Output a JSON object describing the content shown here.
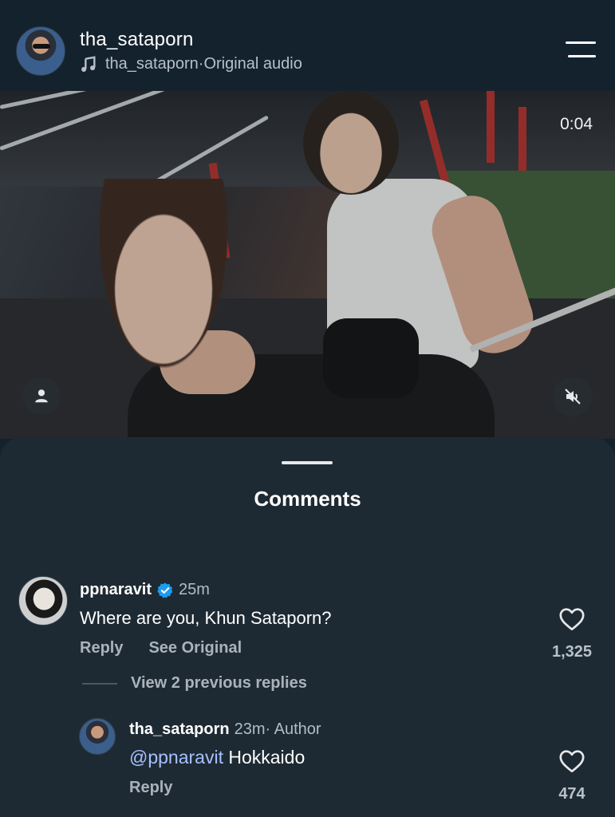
{
  "header": {
    "username": "tha_sataporn",
    "audio_owner": "tha_sataporn",
    "audio_separator": " · ",
    "audio_label": "Original audio"
  },
  "video": {
    "timer": "0:04",
    "icons": {
      "profile": "person-icon",
      "mute": "speaker-muted-icon"
    }
  },
  "comments_sheet": {
    "title": "Comments",
    "comment": {
      "username": "ppnaravit",
      "verified": true,
      "time": "25m",
      "text": "Where are you, Khun Sataporn?",
      "reply_label": "Reply",
      "see_original_label": "See Original",
      "like_count": "1,325"
    },
    "view_replies_label": "View 2 previous replies",
    "reply": {
      "username": "tha_sataporn",
      "time": "23m",
      "author_label": " · Author",
      "mention": "@ppnaravit",
      "text": " Hokkaido",
      "reply_label": "Reply",
      "like_count": "474"
    }
  },
  "colors": {
    "background": "#14222d",
    "sheet": "#1e2a33",
    "mention": "#a8c0ff",
    "verified": "#1d9bf0",
    "muted_text": "#aab3bb"
  }
}
